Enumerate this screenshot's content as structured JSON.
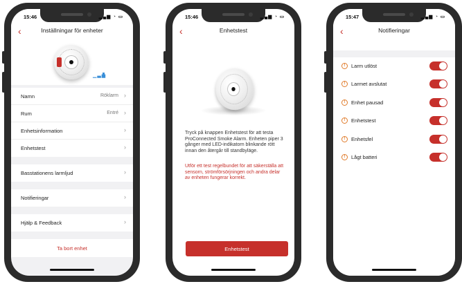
{
  "screens": [
    {
      "time": "15:46",
      "title": "Inställningar för enheter",
      "rows_group1": [
        {
          "label": "Namn",
          "value": "Röklarm"
        },
        {
          "label": "Rum",
          "value": "Entré"
        },
        {
          "label": "Enhetsinformation",
          "value": ""
        },
        {
          "label": "Enhetstest",
          "value": ""
        }
      ],
      "rows_group2": [
        {
          "label": "Basstationens larmljud",
          "value": ""
        }
      ],
      "rows_group3": [
        {
          "label": "Notifieringar",
          "value": ""
        }
      ],
      "rows_group4": [
        {
          "label": "Hjälp & Feedback",
          "value": ""
        }
      ],
      "delete_label": "Ta bort enhet"
    },
    {
      "time": "15:46",
      "title": "Enhetstest",
      "description": "Tryck på knappen Enhetstest för att testa ProConnected Smoke Alarm. Enheten piper 3 gånger med LED-indikatorn blinkande rött innan den återgår till standbyläge.",
      "warning": "Utför ett test regelbundet för att säkerställa att sensorn, strömförsörjningen och andra delar av enheten fungerar korrekt.",
      "button_label": "Enhetstest"
    },
    {
      "time": "15:47",
      "title": "Notifieringar",
      "items": [
        {
          "label": "Larm utlöst",
          "enabled": true
        },
        {
          "label": "Larmet avslutat",
          "enabled": true
        },
        {
          "label": "Enhet pausad",
          "enabled": true
        },
        {
          "label": "Enhetstest",
          "enabled": true
        },
        {
          "label": "Enhetsfel",
          "enabled": true
        },
        {
          "label": "Lågt batteri",
          "enabled": true
        }
      ]
    }
  ],
  "colors": {
    "accent": "#c6302b",
    "warning_icon": "#e07b2a",
    "phone_frame": "#2b2b2b",
    "list_bg": "#f1f1f3"
  },
  "icons": {
    "back": "chevron-left-icon",
    "row": "chevron-right-icon",
    "notification": "warning-circle-icon"
  }
}
